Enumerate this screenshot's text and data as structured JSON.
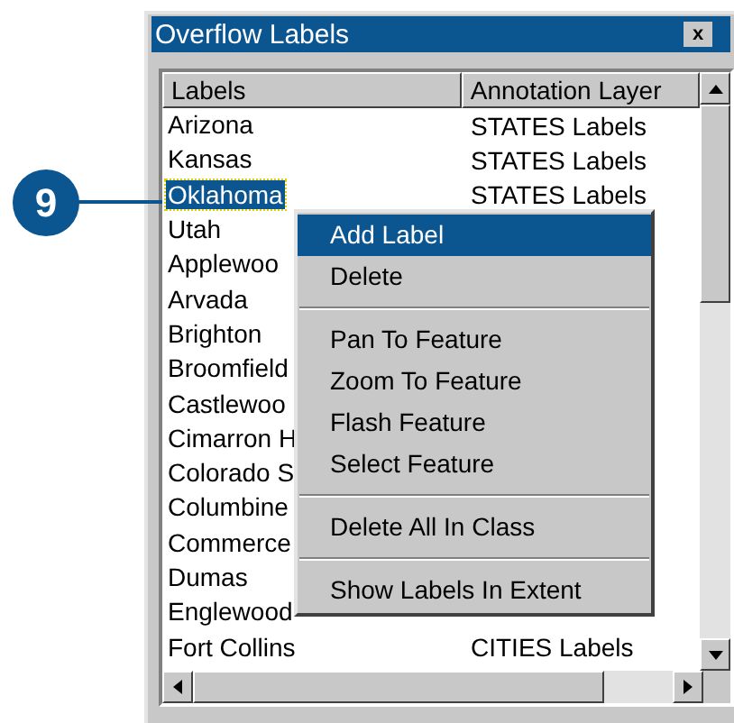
{
  "window": {
    "title": "Overflow Labels",
    "close": "x"
  },
  "callout": {
    "number": "9"
  },
  "table": {
    "columns": [
      "Labels",
      "Annotation Layer"
    ],
    "rows": [
      {
        "label": "Arizona",
        "layer": "STATES Labels",
        "selected": false
      },
      {
        "label": "Kansas",
        "layer": "STATES Labels",
        "selected": false
      },
      {
        "label": "Oklahoma",
        "layer": "STATES Labels",
        "selected": true
      },
      {
        "label": "Utah",
        "selected": false
      },
      {
        "label": "Applewoo",
        "selected": false
      },
      {
        "label": "Arvada",
        "selected": false
      },
      {
        "label": "Brighton",
        "selected": false
      },
      {
        "label": "Broomfield",
        "selected": false
      },
      {
        "label": "Castlewoo",
        "selected": false
      },
      {
        "label": "Cimarron H",
        "selected": false
      },
      {
        "label": "Colorado S",
        "selected": false
      },
      {
        "label": "Columbine",
        "selected": false
      },
      {
        "label": "Commerce",
        "selected": false
      },
      {
        "label": "Dumas",
        "selected": false
      },
      {
        "label": "Englewood",
        "selected": false
      },
      {
        "label": "Fort Collins",
        "layer": "CITIES Labels",
        "selected": false
      }
    ]
  },
  "context_menu": {
    "groups": [
      [
        {
          "label": "Add Label",
          "selected": true
        },
        {
          "label": "Delete",
          "selected": false
        }
      ],
      [
        {
          "label": "Pan To Feature",
          "selected": false
        },
        {
          "label": "Zoom To Feature",
          "selected": false
        },
        {
          "label": "Flash Feature",
          "selected": false
        },
        {
          "label": "Select Feature",
          "selected": false
        }
      ],
      [
        {
          "label": "Delete All In Class",
          "selected": false
        }
      ],
      [
        {
          "label": "Show Labels In Extent",
          "selected": false
        }
      ]
    ]
  }
}
